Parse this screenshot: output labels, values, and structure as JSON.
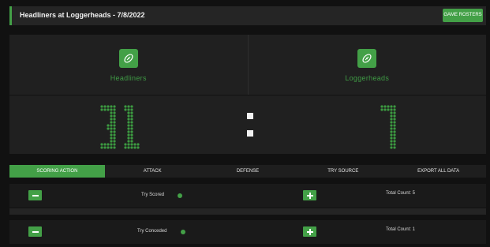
{
  "header": {
    "title": "Headliners at Loggerheads - 7/8/2022",
    "roster_button": "GAME ROSTERS"
  },
  "teams": [
    {
      "name": "Headliners",
      "icon": "football-icon"
    },
    {
      "name": "Loggerheads",
      "icon": "football-icon"
    }
  ],
  "score": {
    "home": "31",
    "away": "7",
    "digit_color": "#3c9a41",
    "separator_color": "#f2f2f2"
  },
  "tabs": [
    {
      "label": "SCORING ACTION",
      "active": true
    },
    {
      "label": "ATTACK",
      "active": false
    },
    {
      "label": "DEFENSE",
      "active": false
    },
    {
      "label": "TRY SOURCE",
      "active": false
    },
    {
      "label": "EXPORT ALL DATA",
      "active": false
    }
  ],
  "actions": [
    {
      "label": "Try Scored",
      "total_text": "Total Count: 5"
    },
    {
      "label": "Try Conceded",
      "total_text": "Total Count: 1"
    }
  ],
  "colors": {
    "accent": "#43a047",
    "background": "#111111",
    "panel": "#202020"
  }
}
